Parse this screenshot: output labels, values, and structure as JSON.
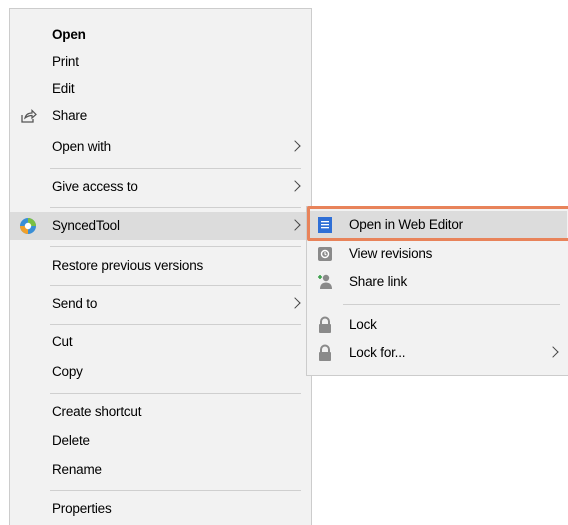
{
  "context_menu": {
    "items": [
      {
        "label": "Open",
        "bold": true
      },
      {
        "label": "Print"
      },
      {
        "label": "Edit"
      },
      {
        "label": "Share",
        "icon": "share-icon"
      },
      {
        "label": "Open with",
        "submenu": true
      },
      {
        "label": "Give access to",
        "submenu": true
      },
      {
        "label": "SyncedTool",
        "submenu": true,
        "icon": "synced-tool-icon",
        "highlighted": true
      },
      {
        "label": "Restore previous versions"
      },
      {
        "label": "Send to",
        "submenu": true
      },
      {
        "label": "Cut"
      },
      {
        "label": "Copy"
      },
      {
        "label": "Create shortcut"
      },
      {
        "label": "Delete"
      },
      {
        "label": "Rename"
      },
      {
        "label": "Properties"
      }
    ]
  },
  "submenu": {
    "items": [
      {
        "label": "Open in Web Editor",
        "icon": "document-icon",
        "highlighted": true
      },
      {
        "label": "View revisions",
        "icon": "revisions-icon"
      },
      {
        "label": "Share link",
        "icon": "share-link-icon"
      },
      {
        "label": "Lock",
        "icon": "lock-icon"
      },
      {
        "label": "Lock for...",
        "icon": "lock-icon",
        "submenu": true
      }
    ]
  },
  "colors": {
    "menu_bg": "#f2f2f2",
    "hover_bg": "#dcdcdc",
    "callout_border": "#e8835a",
    "doc_icon_blue": "#2f6fd6"
  }
}
